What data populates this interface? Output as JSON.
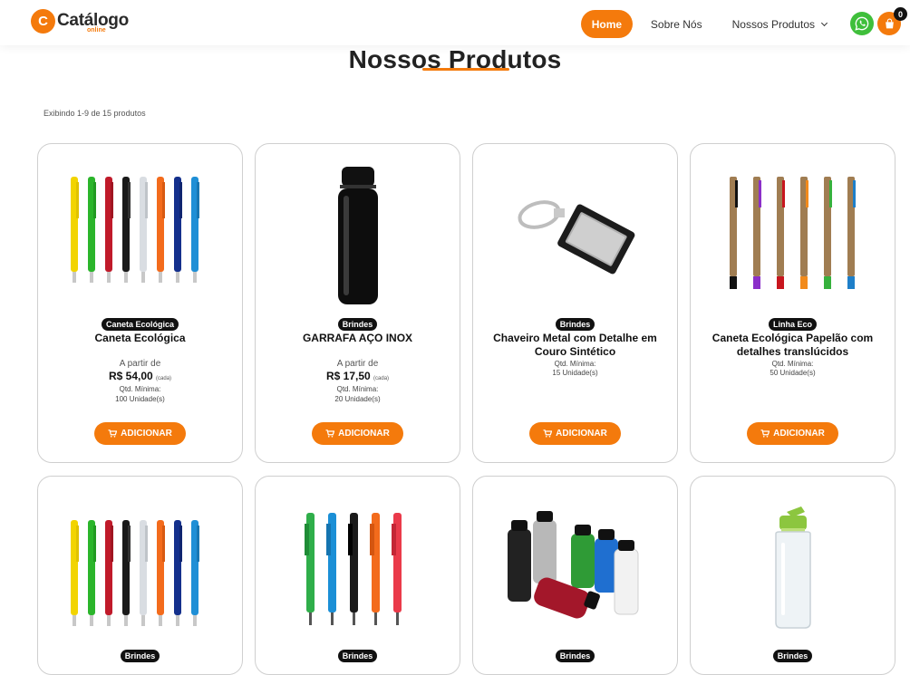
{
  "header": {
    "logo_letter": "C",
    "logo_text": "Catálogo",
    "logo_sub": "online",
    "nav": {
      "home": "Home",
      "about": "Sobre Nós",
      "products": "Nossos Produtos"
    },
    "cart_count": "0",
    "colors": {
      "accent": "#f47a0c",
      "whatsapp": "#3fbf3b"
    },
    "icons": [
      "whatsapp-icon",
      "shopping-bag-icon",
      "chevron-down-icon"
    ]
  },
  "page": {
    "title": "Nossos Produtos",
    "result_count": "Exibindo 1-9 de 15 produtos"
  },
  "products": [
    {
      "category": "Caneta Ecológica",
      "name": "Caneta Ecológica",
      "from_label": "A partir de",
      "price": "R$ 54,00",
      "unit": "(cada)",
      "min_label": "Qtd. Mínima:",
      "min_value": "100 Unidade(s)",
      "button": "ADICIONAR"
    },
    {
      "category": "Brindes",
      "name": "GARRAFA AÇO INOX",
      "from_label": "A partir de",
      "price": "R$ 17,50",
      "unit": "(cada)",
      "min_label": "Qtd. Mínima:",
      "min_value": "20 Unidade(s)",
      "button": "ADICIONAR"
    },
    {
      "category": "Brindes",
      "name": "Chaveiro Metal com Detalhe em Couro Sintético",
      "min_label": "Qtd. Mínima:",
      "min_value": "15 Unidade(s)",
      "button": "ADICIONAR"
    },
    {
      "category": "Linha Eco",
      "name": "Caneta Ecológica Papelão com detalhes translúcidos",
      "min_label": "Qtd. Mínima:",
      "min_value": "50 Unidade(s)",
      "button": "ADICIONAR"
    },
    {
      "category": "Brindes"
    },
    {
      "category": "Brindes"
    },
    {
      "category": "Brindes"
    },
    {
      "category": "Brindes"
    }
  ]
}
